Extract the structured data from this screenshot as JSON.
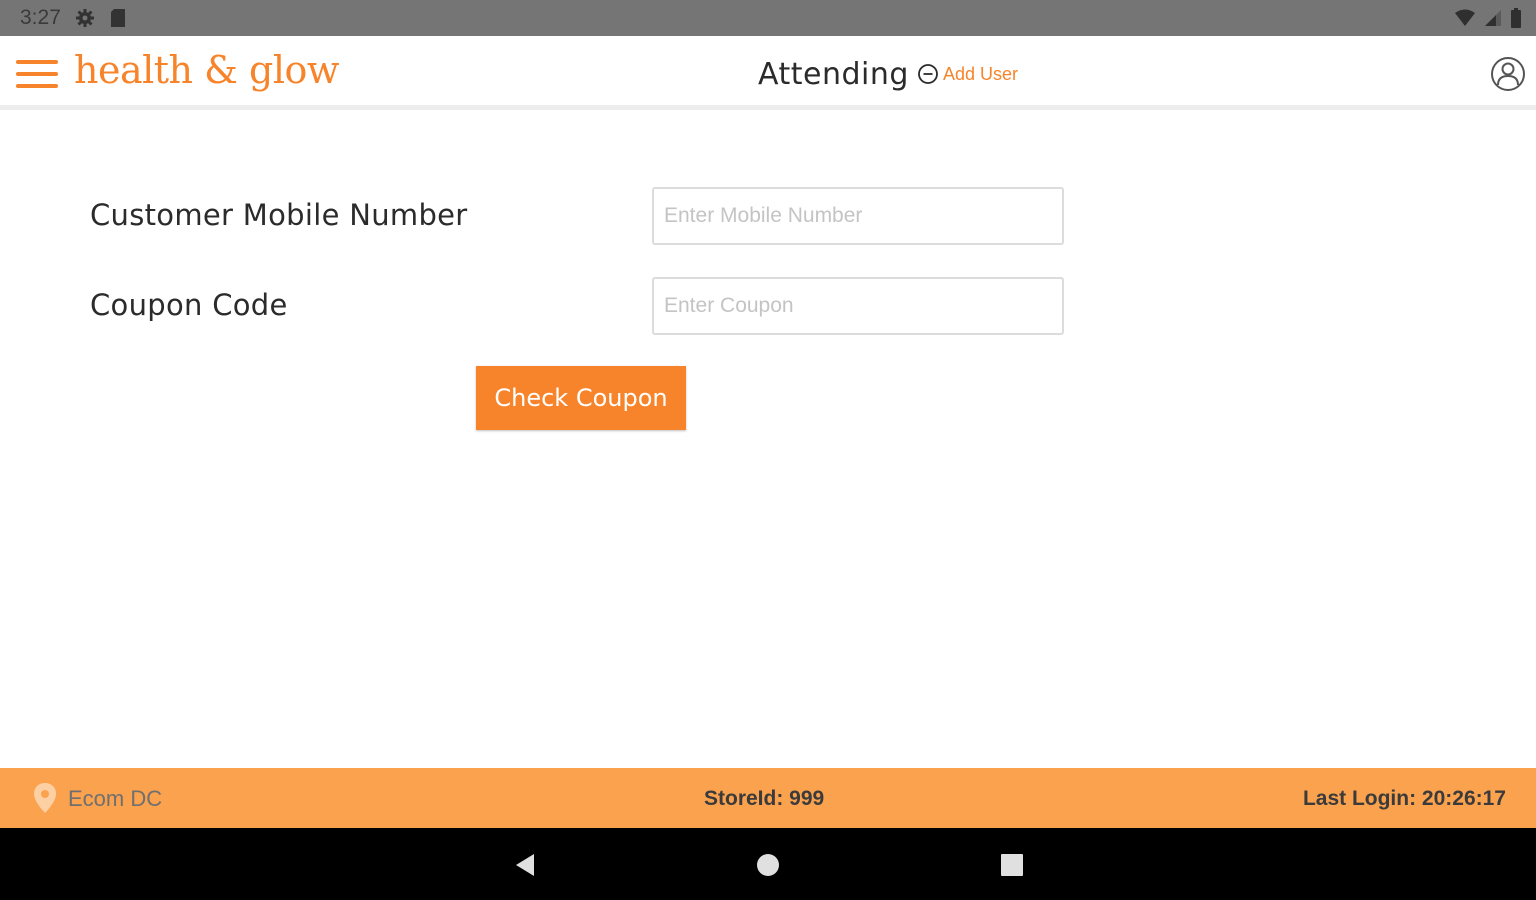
{
  "status_bar": {
    "time": "3:27",
    "icons": [
      "gear-icon",
      "sd-card-icon",
      "wifi-icon",
      "signal-icon",
      "battery-icon"
    ]
  },
  "header": {
    "brand": "health & glow",
    "attending_label": "Attending",
    "add_user_label": "Add User",
    "icons": [
      "menu-icon",
      "add-circle-icon",
      "profile-icon"
    ]
  },
  "form": {
    "mobile_label": "Customer Mobile Number",
    "mobile_value": "",
    "mobile_placeholder": "Enter Mobile Number",
    "coupon_label": "Coupon Code",
    "coupon_value": "",
    "coupon_placeholder": "Enter Coupon",
    "check_button_label": "Check Coupon"
  },
  "footer": {
    "store_name": "Ecom DC",
    "store_id": "StoreId: 999",
    "last_login": "Last Login: 20:26:17"
  },
  "colors": {
    "accent": "#f7842a",
    "footer_background": "#fba24e",
    "status_bar_background": "#757575",
    "nav_bar_background": "#000000"
  }
}
